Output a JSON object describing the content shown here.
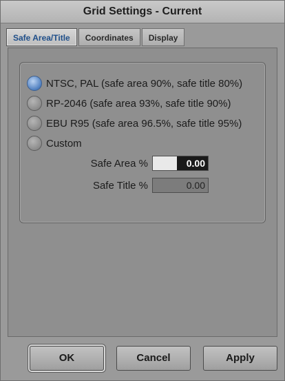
{
  "window": {
    "title": "Grid Settings - Current"
  },
  "tabs": [
    {
      "label": "Safe Area/Title",
      "active": true
    },
    {
      "label": "Coordinates",
      "active": false
    },
    {
      "label": "Display",
      "active": false
    }
  ],
  "safe_area_options": [
    {
      "label": "NTSC, PAL (safe area 90%, safe title 80%)",
      "selected": true
    },
    {
      "label": "RP-2046 (safe area 93%, safe title 90%)",
      "selected": false
    },
    {
      "label": "EBU R95 (safe area 96.5%, safe title 95%)",
      "selected": false
    },
    {
      "label": "Custom",
      "selected": false
    }
  ],
  "fields": {
    "safe_area": {
      "label": "Safe Area %",
      "value": "0.00"
    },
    "safe_title": {
      "label": "Safe Title %",
      "value": "0.00"
    }
  },
  "buttons": {
    "ok": "OK",
    "cancel": "Cancel",
    "apply": "Apply"
  },
  "colors": {
    "accent_tab_text": "#1f4f8a",
    "selected_radio": "#4f7fbf"
  }
}
